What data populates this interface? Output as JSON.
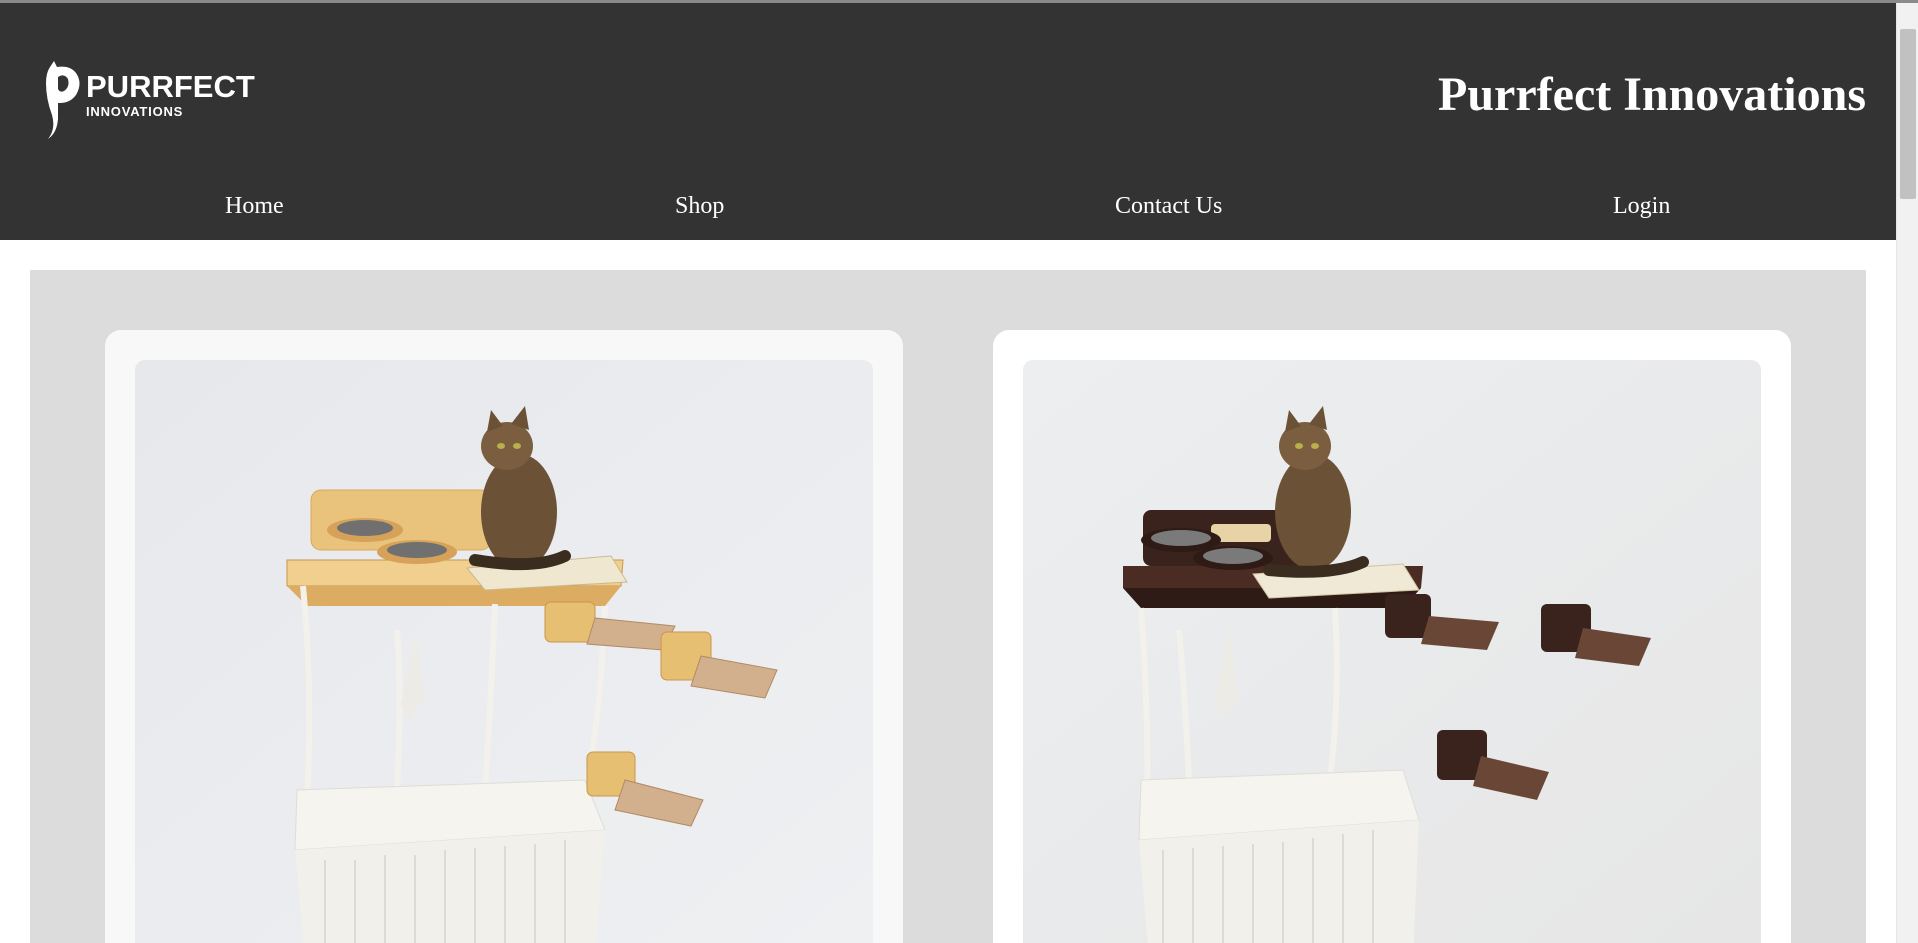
{
  "header": {
    "logo": {
      "word": "PURRFECT",
      "sub": "INNOVATIONS",
      "icon": "cat-silhouette-icon"
    },
    "title": "Purrfect Innovations"
  },
  "nav": {
    "items": [
      {
        "label": "Home"
      },
      {
        "label": "Shop"
      },
      {
        "label": "Contact Us"
      },
      {
        "label": "Login"
      }
    ]
  },
  "products": [
    {
      "image": "cat-shelf-natural-wood-photo",
      "finish": "natural wood"
    },
    {
      "image": "cat-shelf-dark-walnut-photo",
      "finish": "dark walnut"
    }
  ],
  "colors": {
    "header_bg": "#333333",
    "content_bg": "#dcdcdc",
    "card_bg": "#ffffff",
    "wood_light": "#e8c27a",
    "wood_dark": "#4a2c22"
  }
}
